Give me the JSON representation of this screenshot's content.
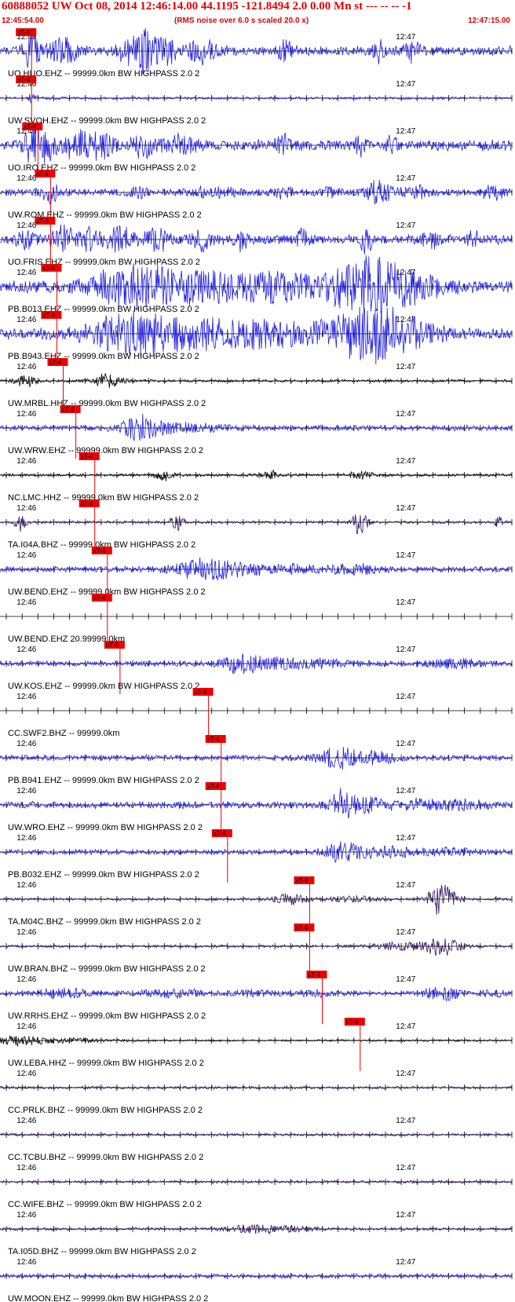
{
  "header": {
    "title": "60888052 UW Oct 08, 2014 12:46:14.00   44.1195 -121.8494  2.0 0.00 Mn st --- -- --  -1",
    "start_time": "12:45:54.00",
    "noise_note": "(RMS noise over 6.0 s scaled 20.0 x)",
    "end_time": "12:47:15.00"
  },
  "chart_data": {
    "type": "line",
    "title": "60888052 UW Oct 08, 2014 12:46:14.00   44.1195 -121.8494  2.0 0.00 Mn st --- -- --  -1",
    "x_axis": {
      "start": "12:45:54.00",
      "end": "12:47:15.00",
      "tick_labels": [
        "12:46",
        "12:47"
      ]
    },
    "pick_label": "xT-4",
    "colors": {
      "blue": "#1f1fe0",
      "black": "#000000",
      "purple": "#2e1560",
      "pick": "#ee0000"
    },
    "traces": [
      {
        "label": "UO.HUO.EHZ -- 99999.0km BW  HIGHPASS  2.0  2",
        "color": "blue",
        "pick": "12:45:59",
        "amp": 7,
        "bursts": [
          [
            5,
            1,
            18
          ],
          [
            10,
            1.5,
            14
          ],
          [
            21,
            1.5,
            18
          ],
          [
            23,
            1,
            15
          ],
          [
            26,
            1.5,
            15
          ],
          [
            32,
            1.5,
            13
          ],
          [
            45,
            0.8,
            13
          ],
          [
            60,
            0.6,
            14
          ],
          [
            65,
            1,
            12
          ],
          [
            82,
            0.7,
            10
          ]
        ]
      },
      {
        "label": "UW.SVOH.EHZ -- 99999.0km BW  HIGHPASS  2.0  2",
        "color": "blue",
        "pick": "12:45:59",
        "amp": 2,
        "bursts": [
          [
            5,
            0.4,
            6
          ]
        ]
      },
      {
        "label": "UO.IRO.EHZ -- 99999.0km BW  HIGHPASS  2.0  2",
        "color": "blue",
        "pick": "12:46:00",
        "amp": 8,
        "bursts": [
          [
            5,
            1,
            16
          ],
          [
            7,
            1.5,
            16
          ],
          [
            12,
            1.5,
            14
          ],
          [
            16,
            1.5,
            14
          ],
          [
            23,
            1.5,
            12
          ],
          [
            29,
            1.2,
            12
          ],
          [
            45,
            0.7,
            12
          ],
          [
            57,
            0.6,
            10
          ],
          [
            62,
            0.6,
            10
          ]
        ]
      },
      {
        "label": "UW.ROM.EHZ -- 99999.0km BW  HIGHPASS  2.0  2",
        "color": "blue",
        "pick": "12:46:02",
        "amp": 5,
        "bursts": [
          [
            8,
            1,
            12
          ],
          [
            22,
            1.2,
            5
          ],
          [
            32,
            1.2,
            5
          ],
          [
            36,
            1.2,
            6
          ],
          [
            45,
            1,
            5
          ],
          [
            52,
            1,
            5
          ],
          [
            60,
            1.5,
            14
          ],
          [
            66,
            1.2,
            8
          ],
          [
            78,
            1.2,
            8
          ]
        ]
      },
      {
        "label": "UO.FRIS.EHZ -- 99999.0km BW  HIGHPASS  2.0  2",
        "color": "blue",
        "pick": "12:46:02",
        "amp": 7,
        "bursts": [
          [
            4,
            1,
            10
          ],
          [
            10,
            1.2,
            14
          ],
          [
            14,
            1.2,
            12
          ],
          [
            19,
            1.5,
            14
          ],
          [
            25,
            1.5,
            12
          ],
          [
            32,
            1.2,
            10
          ],
          [
            38,
            1,
            10
          ],
          [
            48,
            0.8,
            12
          ],
          [
            58,
            0.7,
            14
          ],
          [
            68,
            0.8,
            10
          ],
          [
            75,
            0.8,
            8
          ]
        ]
      },
      {
        "label": "PB.B013.EHZ -- 99999.0km BW  HIGHPASS  2.0  2",
        "color": "blue",
        "pick": "12:46:03",
        "amp": 9,
        "bursts": [
          [
            20,
            4,
            20
          ],
          [
            30,
            6,
            16
          ],
          [
            43,
            5,
            12
          ],
          [
            57,
            4,
            20
          ],
          [
            62,
            5,
            18
          ]
        ]
      },
      {
        "label": "PB.B943.EHZ -- 99999.0km BW  HIGHPASS  2.0  2",
        "color": "blue",
        "pick": "12:46:03",
        "amp": 8,
        "bursts": [
          [
            20,
            4,
            20
          ],
          [
            30,
            6,
            16
          ],
          [
            43,
            5,
            12
          ],
          [
            57,
            4,
            20
          ],
          [
            62,
            5,
            18
          ]
        ]
      },
      {
        "label": "UW.MRBL.HHZ -- 99999.0km BW  HIGHPASS  2.0  2",
        "color": "black",
        "pick": "12:46:04",
        "amp": 2,
        "bursts": [
          [
            4,
            1.2,
            7
          ],
          [
            17,
            1.5,
            10
          ]
        ]
      },
      {
        "label": "UW.WRW.EHZ -- 99999.0km BW  HIGHPASS  2.0  2",
        "color": "blue",
        "pick": "12:46:06",
        "amp": 4,
        "bursts": [
          [
            22,
            2,
            12
          ],
          [
            26,
            3,
            5
          ],
          [
            33,
            3,
            3
          ]
        ]
      },
      {
        "label": "NC.LMC.HHZ -- 99999.0km BW  HIGHPASS  2.0  2",
        "color": "black",
        "pick": "12:46:09",
        "amp": 2,
        "bursts": [
          [
            26,
            1,
            8
          ],
          [
            43,
            1,
            5
          ],
          [
            57,
            1.5,
            4
          ]
        ]
      },
      {
        "label": "TA.I04A.BHZ -- 99999.0km BW  HIGHPASS  2.0  2",
        "color": "purple",
        "pick": "12:46:09",
        "amp": 2,
        "bursts": [
          [
            3.2,
            0.6,
            12
          ],
          [
            28,
            0.8,
            10
          ],
          [
            57,
            0.8,
            16
          ],
          [
            79,
            0.5,
            6
          ]
        ]
      },
      {
        "label": "UW.BEND.EHZ -- 99999.0km BW  HIGHPASS  2.0  2",
        "color": "blue",
        "pick": "12:46:11",
        "amp": 4,
        "bursts": [
          [
            32,
            3,
            12
          ],
          [
            38,
            3,
            6
          ],
          [
            46,
            3,
            5
          ],
          [
            56,
            3,
            5
          ]
        ]
      },
      {
        "label": "UW.BEND.EHZ 20.99999.0km",
        "color": "flat",
        "pick": "12:46:11",
        "amp": 0,
        "bursts": []
      },
      {
        "label": "UW.KOS.EHZ -- 99999.0km BW  HIGHPASS  2.0  2",
        "color": "blue",
        "pick": "12:46:13",
        "amp": 4,
        "bursts": [
          [
            38,
            2,
            12
          ],
          [
            44,
            3,
            5
          ],
          [
            52,
            3,
            4
          ],
          [
            72,
            3,
            4
          ]
        ]
      },
      {
        "label": "CC.SWF2.BHZ -- 99999.0km",
        "color": "flat",
        "pick": "12:46:27",
        "amp": 0,
        "bursts": []
      },
      {
        "label": "PB.B941.EHZ -- 99999.0km BW  HIGHPASS  2.0  2",
        "color": "blue",
        "pick": "12:46:29",
        "amp": 4,
        "bursts": [
          [
            54,
            2.5,
            12
          ],
          [
            60,
            2,
            6
          ]
        ]
      },
      {
        "label": "UW.WRO.EHZ -- 99999.0km BW  HIGHPASS  2.0  2",
        "color": "blue",
        "pick": "12:46:29",
        "amp": 5,
        "bursts": [
          [
            54,
            1,
            12
          ],
          [
            57,
            3,
            10
          ],
          [
            66,
            2,
            5
          ],
          [
            73,
            3,
            4
          ]
        ]
      },
      {
        "label": "PB.B032.EHZ -- 99999.0km BW  HIGHPASS  2.0  2",
        "color": "blue",
        "pick": "12:46:30",
        "amp": 4,
        "bursts": [
          [
            54,
            2,
            12
          ],
          [
            61,
            3,
            6
          ],
          [
            71,
            3,
            4
          ]
        ]
      },
      {
        "label": "TA.M04C.BHZ -- 99999.0km BW  HIGHPASS  2.0  2",
        "color": "purple",
        "pick": "12:46:43",
        "amp": 2,
        "bursts": [
          [
            46,
            2,
            6
          ],
          [
            56,
            3,
            3
          ],
          [
            70,
            1.5,
            22
          ]
        ]
      },
      {
        "label": "UW.BRAN.BHZ -- 99999.0km BW  HIGHPASS  2.0  2",
        "color": "purple",
        "pick": "12:46:43",
        "amp": 2,
        "bursts": [
          [
            63,
            3,
            4
          ],
          [
            70,
            2,
            12
          ]
        ]
      },
      {
        "label": "UW.RRHS.EHZ -- 99999.0km BW  HIGHPASS  2.0  2",
        "color": "blue",
        "pick": "12:46:45",
        "amp": 3,
        "bursts": [
          [
            10,
            3,
            5
          ],
          [
            27,
            4,
            4
          ],
          [
            40,
            3,
            3
          ],
          [
            50,
            3,
            3
          ],
          [
            70,
            2,
            8
          ],
          [
            78,
            1.5,
            4
          ]
        ]
      },
      {
        "label": "UW.LEBA.HHZ -- 99999.0km BW  HIGHPASS  2.0  2",
        "color": "black",
        "pick": "12:46:51",
        "amp": 1.5,
        "bursts": [
          [
            2,
            2,
            5
          ],
          [
            6,
            2,
            3
          ],
          [
            12,
            4,
            2
          ]
        ]
      },
      {
        "label": "CC.PRLK.BHZ -- 99999.0km BW  HIGHPASS  2.0  2",
        "color": "purple",
        "pick": "",
        "amp": 2,
        "bursts": []
      },
      {
        "label": "CC.TCBU.BHZ -- 99999.0km BW  HIGHPASS  2.0  2",
        "color": "purple",
        "pick": "",
        "amp": 2,
        "bursts": []
      },
      {
        "label": "CC.WIFE.BHZ -- 99999.0km BW  HIGHPASS  2.0  2",
        "color": "purple",
        "pick": "",
        "amp": 2,
        "bursts": []
      },
      {
        "label": "TA.I05D.BHZ -- 99999.0km BW  HIGHPASS  2.0  2",
        "color": "purple",
        "pick": "",
        "amp": 2,
        "bursts": [
          [
            40,
            3,
            4
          ],
          [
            46,
            3,
            3
          ]
        ]
      },
      {
        "label": "UW.MOON.EHZ -- 99999.0km BW  HIGHPASS  2.0  2",
        "color": "blue",
        "pick": "",
        "amp": 3,
        "bursts": []
      }
    ]
  }
}
